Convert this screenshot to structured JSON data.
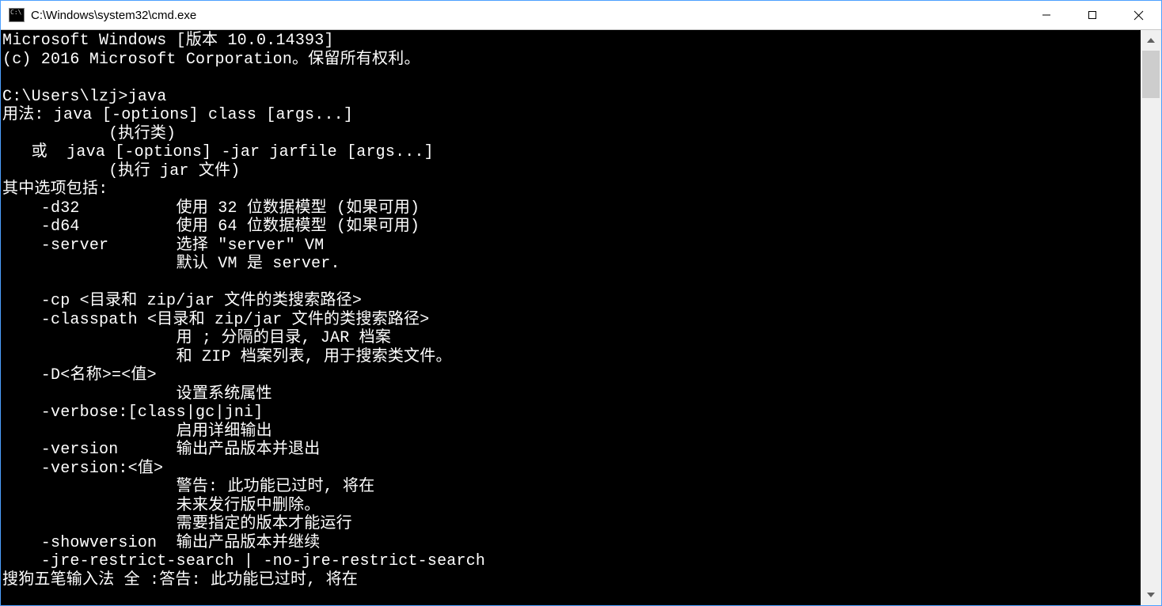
{
  "window": {
    "title": "C:\\Windows\\system32\\cmd.exe"
  },
  "console": {
    "lines": [
      "Microsoft Windows [版本 10.0.14393]",
      "(c) 2016 Microsoft Corporation。保留所有权利。",
      "",
      "C:\\Users\\lzj>java",
      "用法: java [-options] class [args...]",
      "           (执行类)",
      "   或  java [-options] -jar jarfile [args...]",
      "           (执行 jar 文件)",
      "其中选项包括:",
      "    -d32          使用 32 位数据模型 (如果可用)",
      "    -d64          使用 64 位数据模型 (如果可用)",
      "    -server       选择 \"server\" VM",
      "                  默认 VM 是 server.",
      "",
      "    -cp <目录和 zip/jar 文件的类搜索路径>",
      "    -classpath <目录和 zip/jar 文件的类搜索路径>",
      "                  用 ; 分隔的目录, JAR 档案",
      "                  和 ZIP 档案列表, 用于搜索类文件。",
      "    -D<名称>=<值>",
      "                  设置系统属性",
      "    -verbose:[class|gc|jni]",
      "                  启用详细输出",
      "    -version      输出产品版本并退出",
      "    -version:<值>",
      "                  警告: 此功能已过时, 将在",
      "                  未来发行版中删除。",
      "                  需要指定的版本才能运行",
      "    -showversion  输出产品版本并继续",
      "    -jre-restrict-search | -no-jre-restrict-search",
      "搜狗五笔输入法 全 :答告: 此功能已过时, 将在"
    ]
  }
}
